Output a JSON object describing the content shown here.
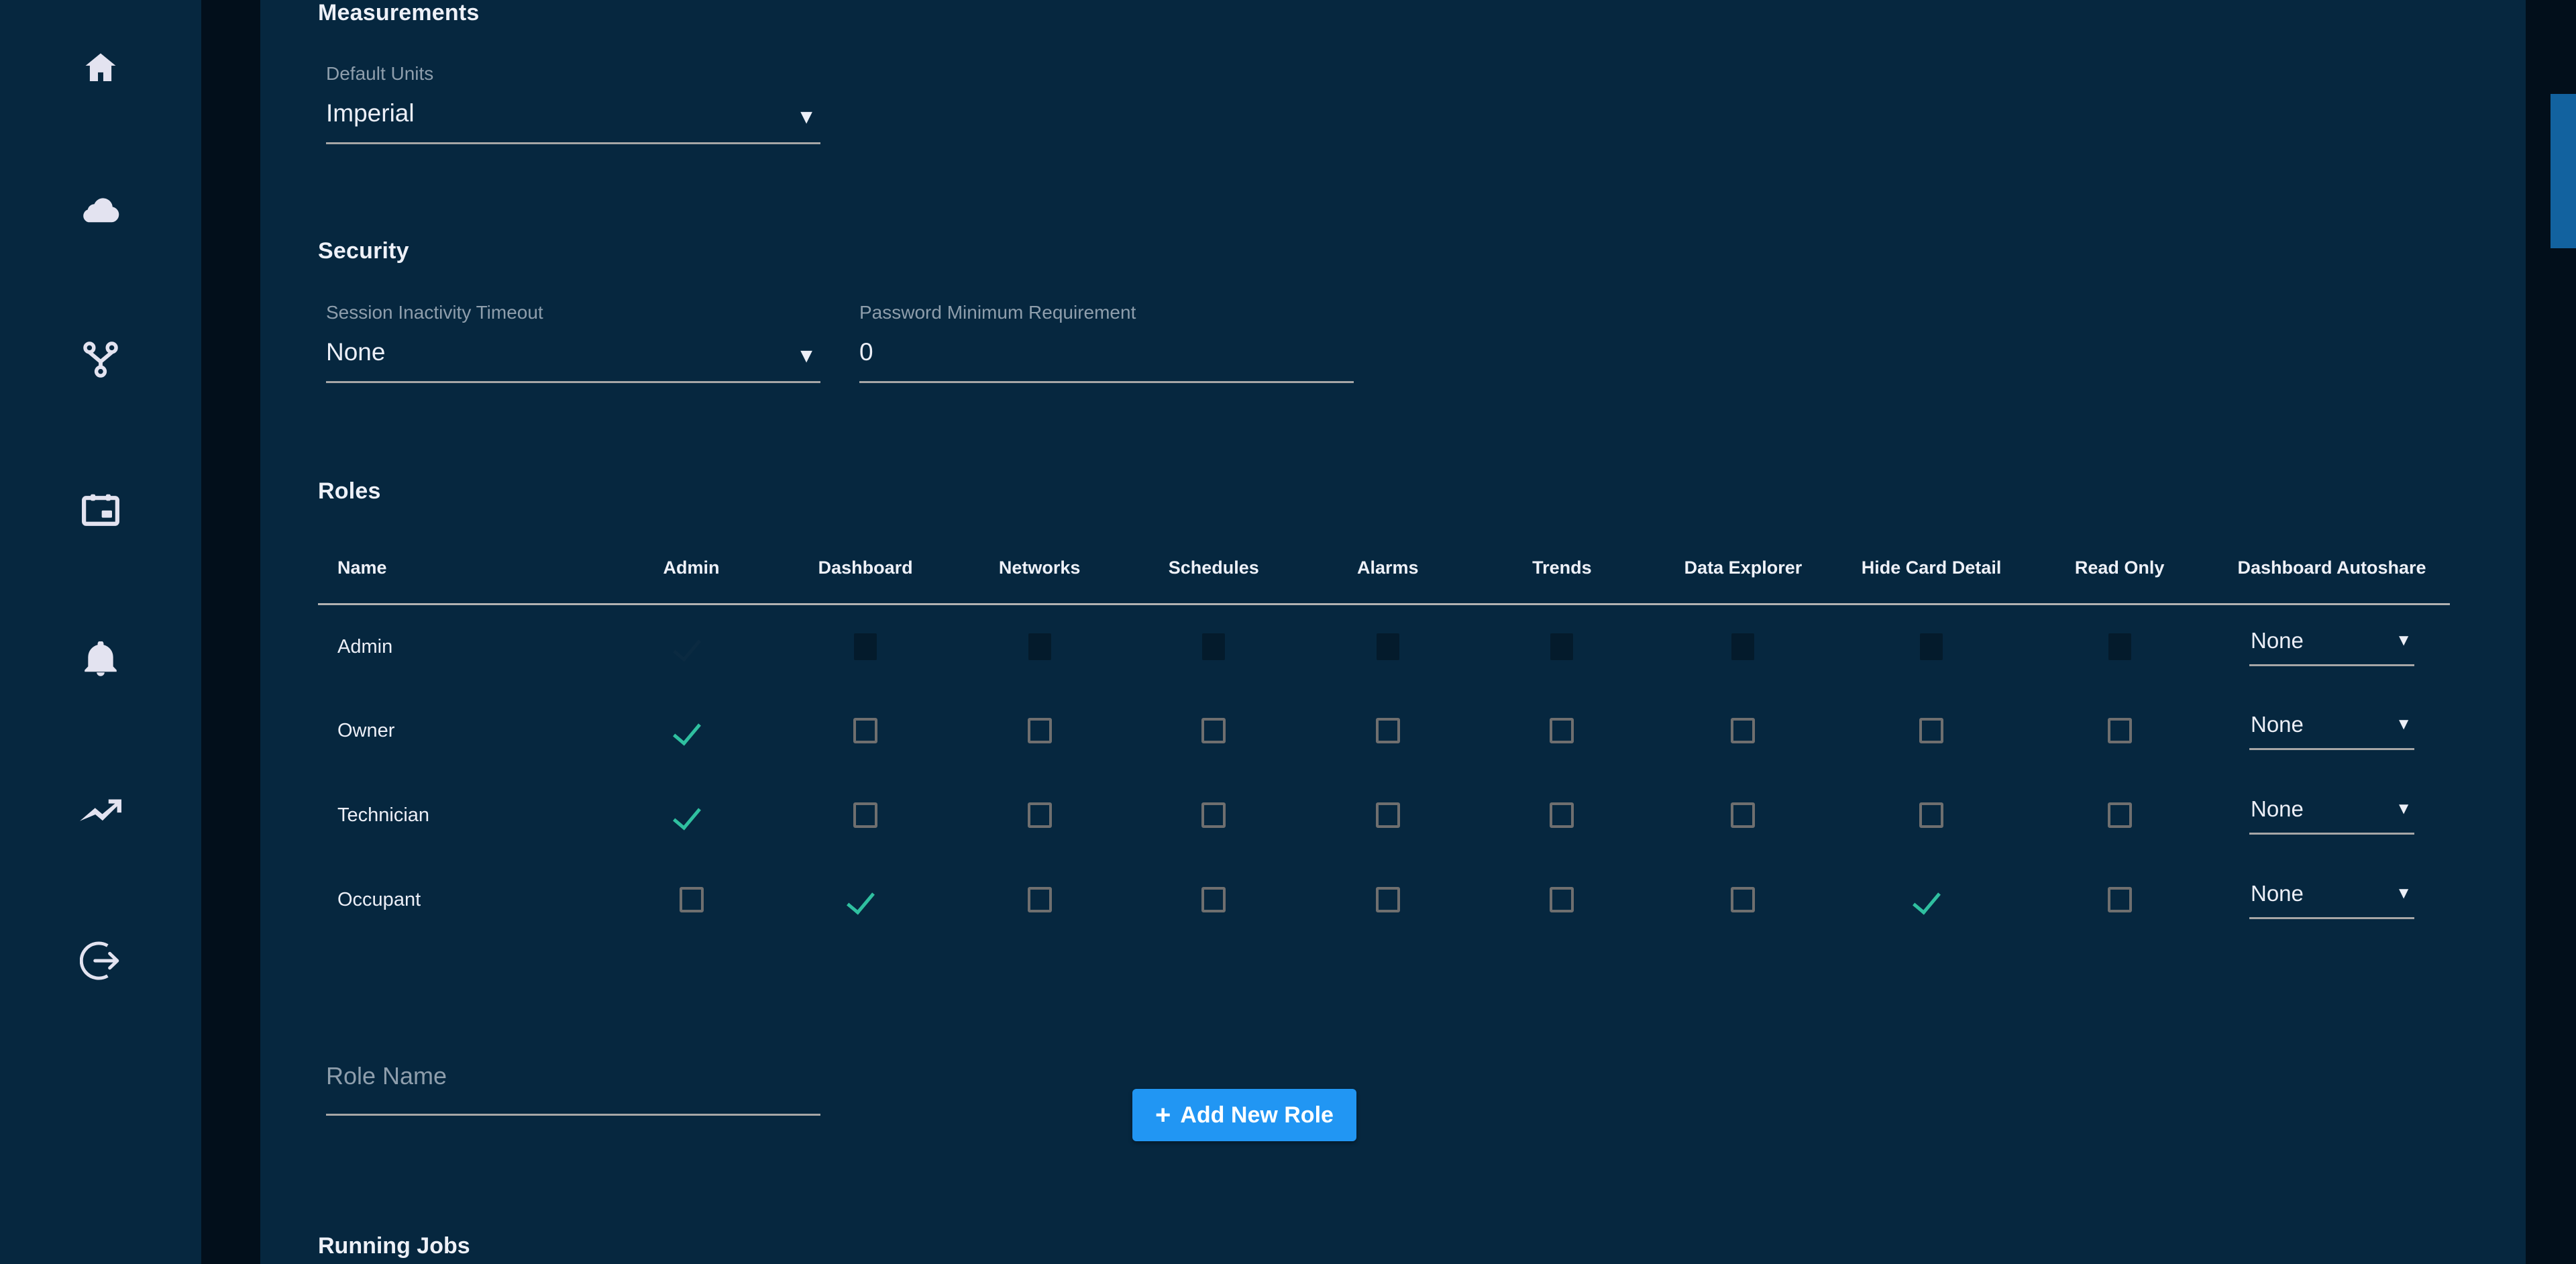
{
  "theme": {
    "background": "#06273f",
    "panel_gap": "#020f1b",
    "accent_blue": "#2196f3",
    "check_teal": "#2fc0a0",
    "text_primary": "#eceff7",
    "text_muted": "#8e9eac",
    "underline": "#a6a6a6",
    "scrollbar_thumb": "#12629f"
  },
  "sidebar": {
    "items": [
      {
        "name": "home-icon",
        "label": "Home"
      },
      {
        "name": "cloud-icon",
        "label": "Cloud"
      },
      {
        "name": "network-topology-icon",
        "label": "Networks"
      },
      {
        "name": "calendar-icon",
        "label": "Schedules"
      },
      {
        "name": "bell-icon",
        "label": "Alarms"
      },
      {
        "name": "trending-up-icon",
        "label": "Trends"
      },
      {
        "name": "logout-icon",
        "label": "Logout"
      }
    ]
  },
  "measurements": {
    "title": "Measurements",
    "default_units": {
      "label": "Default Units",
      "value": "Imperial",
      "caret": "▼"
    }
  },
  "security": {
    "title": "Security",
    "session_timeout": {
      "label": "Session Inactivity Timeout",
      "value": "None",
      "caret": "▼"
    },
    "password_minimum": {
      "label": "Password Minimum Requirement",
      "value": "0"
    }
  },
  "roles": {
    "title": "Roles",
    "columns": [
      "Name",
      "Admin",
      "Dashboard",
      "Networks",
      "Schedules",
      "Alarms",
      "Trends",
      "Data Explorer",
      "Hide Card Detail",
      "Read Only",
      "Dashboard Autoshare"
    ],
    "rows": [
      {
        "name": "Admin",
        "disabled": true,
        "admin": "checked",
        "dashboard": "unchecked",
        "networks": "unchecked",
        "schedules": "unchecked",
        "alarms": "unchecked",
        "trends": "unchecked",
        "data_explorer": "unchecked",
        "hide_card_detail": "unchecked",
        "read_only": "unchecked",
        "autoshare": "None"
      },
      {
        "name": "Owner",
        "disabled": false,
        "admin": "checked",
        "dashboard": "unchecked",
        "networks": "unchecked",
        "schedules": "unchecked",
        "alarms": "unchecked",
        "trends": "unchecked",
        "data_explorer": "unchecked",
        "hide_card_detail": "unchecked",
        "read_only": "unchecked",
        "autoshare": "None"
      },
      {
        "name": "Technician",
        "disabled": false,
        "admin": "checked",
        "dashboard": "unchecked",
        "networks": "unchecked",
        "schedules": "unchecked",
        "alarms": "unchecked",
        "trends": "unchecked",
        "data_explorer": "unchecked",
        "hide_card_detail": "unchecked",
        "read_only": "unchecked",
        "autoshare": "None"
      },
      {
        "name": "Occupant",
        "disabled": false,
        "admin": "unchecked",
        "dashboard": "checked",
        "networks": "unchecked",
        "schedules": "unchecked",
        "alarms": "unchecked",
        "trends": "unchecked",
        "data_explorer": "unchecked",
        "hide_card_detail": "checked",
        "read_only": "unchecked",
        "autoshare": "None"
      }
    ],
    "autoshare_caret": "▼",
    "role_name_placeholder": "Role Name",
    "role_name_value": "",
    "add_button_label": "Add New Role",
    "add_button_plus": "+"
  },
  "running_jobs": {
    "title": "Running Jobs"
  }
}
